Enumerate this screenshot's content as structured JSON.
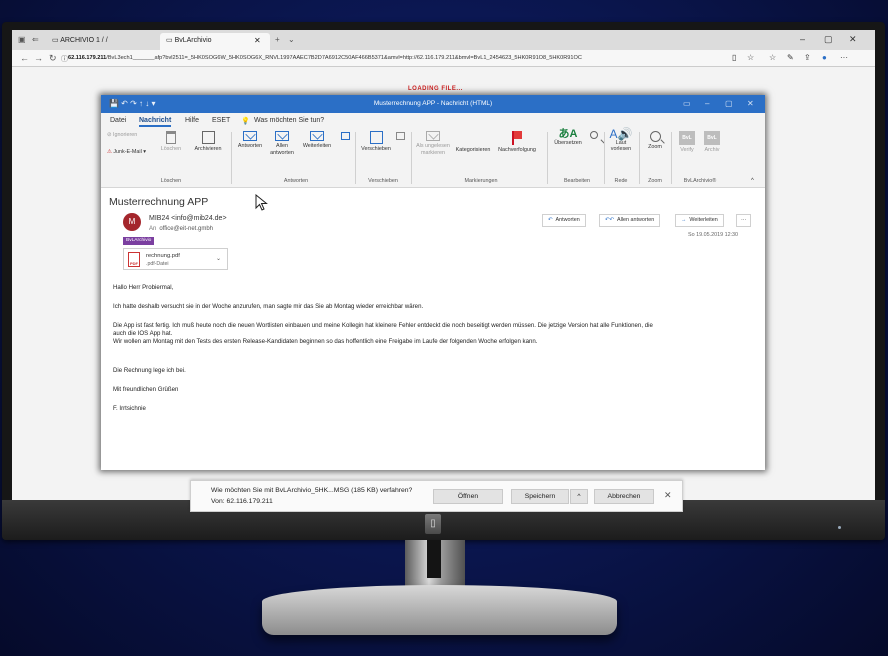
{
  "browser": {
    "tabs": [
      {
        "label": "ARCHIVIO 1 / /"
      },
      {
        "label": "BvLArchivio"
      }
    ],
    "url_host": "62.116.179.211",
    "url_rest": "/BvL3ech1_______afp?bvl2511=_5HK0SOG6W_5HK0SOG6X_RNVL1997AAEC7B2D7A6912C50AF466B5371&amvl=http://62.116.179.211&bmvl=BvL1_2454623_5HK0R91O8_5HK0R91OC"
  },
  "overlay": {
    "loading": "LOADING FILE..."
  },
  "outlook": {
    "title": "Musterrechnung APP  -  Nachricht (HTML)",
    "menu": [
      "Datei",
      "Nachricht",
      "Hilfe",
      "ESET"
    ],
    "search": "Was möchten Sie tun?",
    "ribbon": {
      "ignore": "Ignorieren",
      "junk": "Junk-E-Mail",
      "delete": "Löschen",
      "archive": "Archivieren",
      "reply": "Antworten",
      "reply_all": "Allen antworten",
      "forward": "Weiterleiten",
      "move": "Verschieben",
      "mark_unread": "Als ungelesen markieren",
      "categorize": "Kategorisieren",
      "followup": "Nachverfolgung",
      "translate": "Übersetzen",
      "read_aloud": "Laut vorlesen",
      "zoom": "Zoom",
      "verify": "Verify",
      "archiv": "Archiv",
      "groups": {
        "delete": "Löschen",
        "respond": "Antworten",
        "move": "Verschieben",
        "tags": "Markierungen",
        "edit": "Bearbeiten",
        "speech": "Rede",
        "zoom": "Zoom",
        "bvl": "BvLArchivio®"
      }
    }
  },
  "message": {
    "subject": "Musterrechnung APP",
    "avatar_initial": "M",
    "sender": "MIB24 <info@mib24.de>",
    "to_label": "An",
    "to": "office@eit-net.gmbh",
    "tag": "BvLArchivio",
    "reply": "Antworten",
    "reply_all": "Allen antworten",
    "forward": "Weiterleiten",
    "more": "···",
    "date": "So 19.05.2019 12:30",
    "attachment": {
      "name": "rechnung.pdf",
      "type": ".pdf-Datei"
    },
    "body": [
      "Hallo Herr Probiermal,",
      "Ich hatte deshalb versucht sie in der Woche anzurufen, man sagte mir das Sie ab Montag wieder erreichbar wären.",
      "Die App ist fast fertig. Ich muß heute noch die neuen Wortlisten einbauen und meine Kollegin hat kleinere Fehler entdeckt die noch beseitigt werden müssen. Die jetzige Version hat alle Funktionen, die",
      "auch die IOS App hat.",
      "Wir wollen am Montag mit den Tests des ersten Release-Kandidaten beginnen so das hoffentlich eine Freigabe im Laufe der folgenden Woche erfolgen kann.",
      "Die Rechnung lege ich bei.",
      "Mit freundlichen Grüßen",
      "F. Irrtsichnie"
    ]
  },
  "download": {
    "question": "Wie möchten Sie mit BvLArchivio_5HK...MSG (185 KB) verfahren?",
    "from": "Von: 62.116.179.211",
    "open": "Öffnen",
    "save": "Speichern",
    "save_arrow": "^",
    "cancel": "Abbrechen",
    "close": "✕"
  },
  "colors": {
    "outlook_blue": "#2b6fc6",
    "avatar": "#a4262c",
    "tag": "#7b3fa0",
    "loading": "#cc1f1f"
  }
}
